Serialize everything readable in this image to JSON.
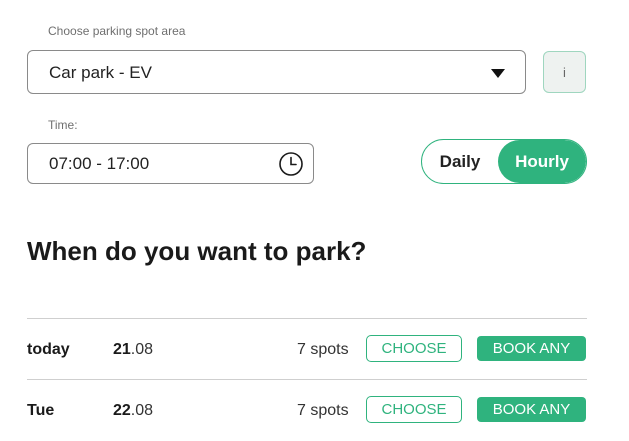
{
  "parking_area": {
    "label": "Choose parking spot area",
    "selected": "Car park - EV",
    "info_label": "i"
  },
  "time": {
    "label": "Time:",
    "value": "07:00 - 17:00"
  },
  "mode_toggle": {
    "daily": "Daily",
    "hourly": "Hourly",
    "active": "Hourly"
  },
  "heading": "When do you want to park?",
  "days": [
    {
      "day": "today",
      "date_day": "21",
      "date_month": ".08",
      "spots": "7 spots",
      "choose": "CHOOSE",
      "book": "BOOK ANY"
    },
    {
      "day": "Tue",
      "date_day": "22",
      "date_month": ".08",
      "spots": "7 spots",
      "choose": "CHOOSE",
      "book": "BOOK ANY"
    }
  ],
  "colors": {
    "accent": "#2fb37e",
    "text": "#1a1a1a",
    "border": "#8a8a8a"
  }
}
